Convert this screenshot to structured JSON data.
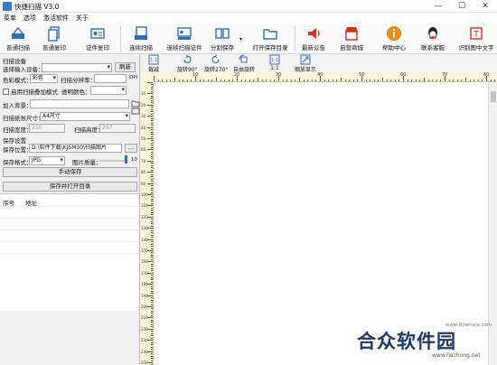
{
  "window": {
    "title": "快捷扫描 V3.0",
    "min": "—",
    "max": "☐",
    "close": "✕"
  },
  "menu": [
    "菜单",
    "选项",
    "激活软件",
    "关于"
  ],
  "toolbar": [
    {
      "label": "普通扫描",
      "icon": "scan-icon"
    },
    {
      "label": "普通复印",
      "icon": "copy-icon"
    },
    {
      "label": "证件复印",
      "icon": "id-copy-icon"
    },
    {
      "label": "连续扫描",
      "icon": "continuous-scan-icon"
    },
    {
      "label": "连续扫描证件",
      "icon": "continuous-id-scan-icon"
    },
    {
      "label": "分割保存",
      "icon": "split-save-icon"
    },
    {
      "label": "打开保存目录",
      "icon": "folder-icon"
    },
    {
      "label": "最新公告",
      "icon": "announcement-icon"
    },
    {
      "label": "自营商城",
      "icon": "store-icon"
    },
    {
      "label": "帮助中心",
      "icon": "help-icon"
    },
    {
      "label": "联系客服",
      "icon": "qq-icon"
    },
    {
      "label": "识别图中文字",
      "icon": "ocr-icon"
    }
  ],
  "scan_settings": {
    "section": "扫描设备",
    "device_label": "选择输入设备：",
    "device_value": "",
    "refresh": "刷新",
    "color_label": "色彩模式：",
    "color_value": "彩色",
    "resolution_label": "扫描分辨率：",
    "resolution_value": "",
    "resolution_unit": "DPI",
    "overlay_label": "启用扫描叠加模式",
    "overlay_checked": false,
    "transparency_label": "透明颜色：",
    "background_label": "加入背景：",
    "paper_label": "扫描纸张尺寸：",
    "paper_value": "A4尺寸",
    "width_label": "扫描宽度：",
    "width_value": "210",
    "height_label": "扫描高度：",
    "height_value": "297"
  },
  "save_settings": {
    "section": "保存设置",
    "location_label": "保存位置：",
    "location_value": "D:\\软件下载\\KJSM30\\扫描图片",
    "browse": "...",
    "format_label": "保存格式：",
    "format_value": "JPG",
    "quality_label": "图片质量：",
    "quality_value": "10",
    "manual_save": "手动保存",
    "save_open": "保存并打开目录"
  },
  "table": {
    "columns": [
      "序号",
      "地址"
    ],
    "rows": []
  },
  "view_toolbar": [
    {
      "label": "裁减",
      "icon": "crop-icon"
    },
    {
      "label": "旋转90°",
      "icon": "rotate-cw-icon"
    },
    {
      "label": "旋转270°",
      "icon": "rotate-ccw-icon"
    },
    {
      "label": "自由旋转",
      "icon": "free-rotate-icon"
    },
    {
      "label": "1:1",
      "icon": "actual-size-icon"
    },
    {
      "label": "缩放显示",
      "icon": "fit-icon"
    }
  ],
  "ruler_h": [
    "10",
    "20",
    "30",
    "40",
    "50",
    "60",
    "70",
    "80"
  ],
  "ruler_v": [
    "10",
    "20",
    "30",
    "40",
    "50",
    "60",
    "70",
    "80",
    "90",
    "100",
    "110",
    "120",
    "130",
    "140",
    "150",
    "160",
    "170",
    "180",
    "190",
    "200",
    "210",
    "220",
    "230",
    "240",
    "250"
  ],
  "watermark": {
    "name": "合众软件园",
    "url": "www.hezhong.net",
    "top": "www.downxia.com"
  }
}
